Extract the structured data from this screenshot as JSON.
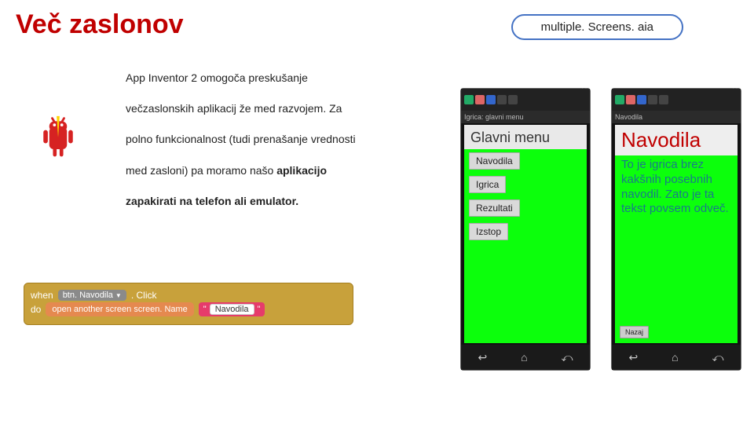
{
  "title": "Več zaslonov",
  "file_label": "multiple. Screens. aia",
  "paragraph": {
    "p1": "App Inventor 2 omogoča preskušanje",
    "p2": "večzaslonskih aplikacij že med razvojem. Za",
    "p3": "polno funkcionalnost (tudi prenašanje vrednosti",
    "p4_a": "med zasloni) pa moramo našo ",
    "p4_b": "aplikacijo",
    "p5": "zapakirati na telefon ali emulator."
  },
  "block": {
    "when": "when",
    "component": "btn. Navodila",
    "event": ". Click",
    "do": "do",
    "open": "open another screen  screen. Name",
    "q1": "\"",
    "value": "Navodila",
    "q2": "\""
  },
  "phone1": {
    "titlebar": "Igrica: glavni menu",
    "heading": "Glavni menu",
    "items": [
      "Navodila",
      "Igrica",
      "Rezultati",
      "Izstop"
    ]
  },
  "phone2": {
    "titlebar": "Navodila",
    "heading": "Navodila",
    "body": "To je igrica brez kakšnih posebnih navodil. Zato je ta tekst povsem odveč.",
    "back": "Nazaj"
  },
  "win": {
    "dash": "—",
    "x": "✕"
  },
  "nav": {
    "back": "↩",
    "home": "⌂",
    "recent": "⤺"
  }
}
